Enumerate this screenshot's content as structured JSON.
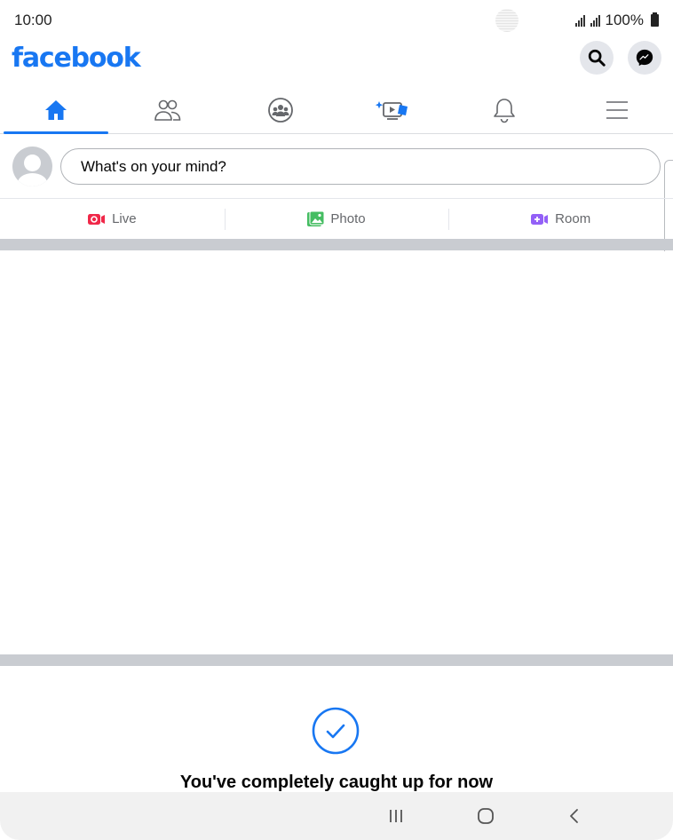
{
  "status_bar": {
    "time": "10:00",
    "battery": "100%"
  },
  "header": {
    "logo": "facebook",
    "search_icon": "search-icon",
    "messenger_icon": "messenger-icon"
  },
  "tabs": [
    {
      "name": "home",
      "icon": "home-icon",
      "active": true
    },
    {
      "name": "friends",
      "icon": "friends-icon",
      "active": false
    },
    {
      "name": "groups",
      "icon": "groups-icon",
      "active": false
    },
    {
      "name": "watch",
      "icon": "watch-icon",
      "active": false
    },
    {
      "name": "notifications",
      "icon": "bell-icon",
      "active": false
    },
    {
      "name": "menu",
      "icon": "menu-icon",
      "active": false
    }
  ],
  "composer": {
    "placeholder": "What's on your mind?"
  },
  "actions": {
    "live": "Live",
    "photo": "Photo",
    "room": "Room"
  },
  "feed": {
    "caught_up_title": "You've completely caught up for now"
  },
  "colors": {
    "brand": "#1877f2",
    "live": "#f02849",
    "photo": "#45bd62",
    "room": "#9360f7",
    "divider": "#c9ccd1"
  }
}
